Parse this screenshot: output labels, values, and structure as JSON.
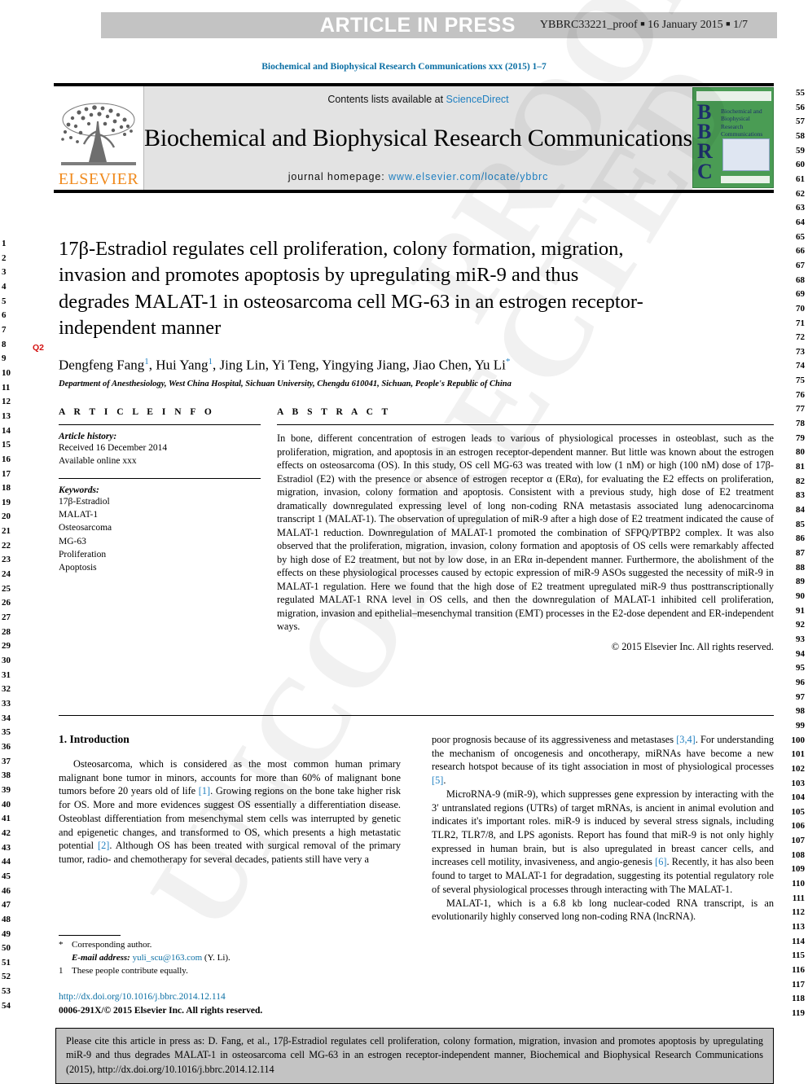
{
  "header": {
    "press_label": "ARTICLE IN PRESS",
    "proof_meta_prefix": "YBBRC33221_proof",
    "proof_date": "16 January 2015",
    "proof_page": "1/7"
  },
  "journal_ref": "Biochemical and Biophysical Research Communications xxx (2015) 1–7",
  "masthead": {
    "contents_prefix": "Contents lists available at ",
    "contents_link": "ScienceDirect",
    "journal_name": "Biochemical and Biophysical Research Communications",
    "homepage_label": "journal homepage: ",
    "homepage_url": "www.elsevier.com/locate/ybbrc",
    "publisher_name": "ELSEVIER",
    "cover_letters": "BBRC",
    "cover_journal_title": "Biochemical and Biophysical Research Communications"
  },
  "flags": {
    "q2": "Q2"
  },
  "title": "17β-Estradiol regulates cell proliferation, colony formation, migration, invasion and promotes apoptosis by upregulating miR-9 and thus degrades MALAT-1 in osteosarcoma cell MG-63 in an estrogen receptor-independent manner",
  "authors": [
    {
      "name": "Dengfeng Fang",
      "sup": "1"
    },
    {
      "name": "Hui Yang",
      "sup": "1"
    },
    {
      "name": "Jing Lin",
      "sup": ""
    },
    {
      "name": "Yi Teng",
      "sup": ""
    },
    {
      "name": "Yingying Jiang",
      "sup": ""
    },
    {
      "name": "Jiao Chen",
      "sup": ""
    },
    {
      "name": "Yu Li",
      "sup": "*"
    }
  ],
  "affiliation": "Department of Anesthesiology, West China Hospital, Sichuan University, Chengdu 610041, Sichuan, People's Republic of China",
  "article_info": {
    "heading": "A R T I C L E   I N F O",
    "history_label": "Article history:",
    "history_lines": [
      "Received 16 December 2014",
      "Available online xxx"
    ],
    "keywords_label": "Keywords:",
    "keywords": [
      "17β-Estradiol",
      "MALAT-1",
      "Osteosarcoma",
      "MG-63",
      "Proliferation",
      "Apoptosis"
    ]
  },
  "abstract": {
    "heading": "A B S T R A C T",
    "text": "In bone, different concentration of estrogen leads to various of physiological processes in osteoblast, such as the proliferation, migration, and apoptosis in an estrogen receptor-dependent manner. But little was known about the estrogen effects on osteosarcoma (OS). In this study, OS cell MG-63 was treated with low (1 nM) or high (100 nM) dose of 17β-Estradiol (E2) with the presence or absence of estrogen receptor α (ERα), for evaluating the E2 effects on proliferation, migration, invasion, colony formation and apoptosis. Consistent with a previous study, high dose of E2 treatment dramatically downregulated expressing level of long non-coding RNA metastasis associated lung adenocarcinoma transcript 1 (MALAT-1). The observation of upregulation of miR-9 after a high dose of E2 treatment indicated the cause of MALAT-1 reduction. Downregulation of MALAT-1 promoted the combination of SFPQ/PTBP2 complex. It was also observed that the proliferation, migration, invasion, colony formation and apoptosis of OS cells were remarkably affected by high dose of E2 treatment, but not by low dose, in an ERα in-dependent manner. Furthermore, the abolishment of the effects on these physiological processes caused by ectopic expression of miR-9 ASOs suggested the necessity of miR-9 in MALAT-1 regulation. Here we found that the high dose of E2 treatment upregulated miR-9 thus posttranscriptionally regulated MALAT-1 RNA level in OS cells, and then the downregulation of MALAT-1 inhibited cell proliferation, migration, invasion and epithelial–mesenchymal transition (EMT) processes in the E2-dose dependent and ER-independent ways.",
    "copyright": "© 2015 Elsevier Inc. All rights reserved."
  },
  "introduction": {
    "heading": "1. Introduction",
    "left_paragraph_1_a": "Osteosarcoma, which is considered as the most common human primary malignant bone tumor in minors, accounts for more than 60% of malignant bone tumors before 20 years old of life ",
    "ref1": "[1]",
    "left_paragraph_1_b": ". Growing regions on the bone take higher risk for OS. More and more evidences suggest OS essentially a differentiation disease. Osteoblast differentiation from mesenchymal stem cells was interrupted by genetic and epigenetic changes, and transformed to OS, which presents a high metastatic potential ",
    "ref2": "[2]",
    "left_paragraph_1_c": ". Although OS has been treated with surgical removal of the primary tumor, radio- and chemotherapy for several decades, patients still have very a",
    "right_paragraph_1_a": "poor prognosis because of its aggressiveness and metastases ",
    "ref34": "[3,4]",
    "right_paragraph_1_b": ". For understanding the mechanism of oncogenesis and oncotherapy, miRNAs have become a new research hotspot because of its tight association in most of physiological processes ",
    "ref5": "[5]",
    "right_paragraph_1_c": ".",
    "right_paragraph_2_a": "MicroRNA-9 (miR-9), which suppresses gene expression by interacting with the 3′ untranslated regions (UTRs) of target mRNAs, is ancient in animal evolution and indicates it's important roles. miR-9 is induced by several stress signals, including TLR2, TLR7/8, and LPS agonists. Report has found that miR-9 is not only highly expressed in human brain, but is also upregulated in breast cancer cells, and increases cell motility, invasiveness, and angio-genesis ",
    "ref6": "[6]",
    "right_paragraph_2_b": ". Recently, it has also been found to target to MALAT-1 for degradation, suggesting its potential regulatory role of several physiological processes through interacting with The MALAT-1.",
    "right_paragraph_3": "MALAT-1, which is a 6.8 kb long nuclear-coded RNA transcript, is an evolutionarily highly conserved long non-coding RNA (lncRNA)."
  },
  "footnotes": {
    "corresponding_marker": "*",
    "corresponding_text": "Corresponding author.",
    "email_label": "E-mail address:",
    "email_value": "yuli_scu@163.com",
    "email_owner": "(Y. Li).",
    "equal_marker": "1",
    "equal_text": "These people contribute equally.",
    "doi_url": "http://dx.doi.org/10.1016/j.bbrc.2014.12.114",
    "issn_line": "0006-291X/© 2015 Elsevier Inc. All rights reserved."
  },
  "citation_box": {
    "text": "Please cite this article in press as: D. Fang, et al., 17β-Estradiol regulates cell proliferation, colony formation, migration, invasion and promotes apoptosis by upregulating miR-9 and thus degrades MALAT-1 in osteosarcoma cell MG-63 in an estrogen receptor-independent manner, Biochemical and Biophysical Research Communications (2015), http://dx.doi.org/10.1016/j.bbrc.2014.12.114"
  },
  "line_numbers": {
    "left_start": 1,
    "left_end": 54,
    "right_start": 55,
    "right_end": 119
  },
  "watermark": {
    "text": "UNCORRECTED PROOF",
    "part_a": "PROOF",
    "part_b": "UNCORRECTED"
  },
  "colors": {
    "link": "#1f7fc0",
    "journal_ref": "#0b6fa4",
    "press_bar_bg": "#c3c3c3",
    "masthead_bg": "#e3e3e3",
    "elsevier_orange": "#f08a1d",
    "cover_green": "#4a9c54",
    "cover_navy": "#1d2f6b",
    "flag_red": "#d31010"
  }
}
